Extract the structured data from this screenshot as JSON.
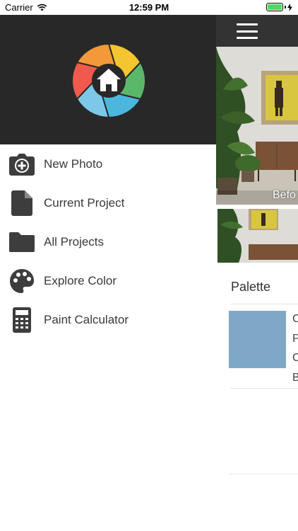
{
  "status_bar": {
    "carrier": "Carrier",
    "time": "12:59 PM",
    "battery_level": 1.0,
    "battery_color": "#4cd964"
  },
  "drawer": {
    "header_color": "#282828",
    "logo_icon": "camera-aperture-house-icon",
    "items": [
      {
        "label": "New Photo",
        "icon": "camera-add-icon"
      },
      {
        "label": "Current Project",
        "icon": "document-icon"
      },
      {
        "label": "All Projects",
        "icon": "folder-icon"
      },
      {
        "label": "Explore Color",
        "icon": "palette-icon"
      },
      {
        "label": "Paint Calculator",
        "icon": "calculator-icon"
      }
    ]
  },
  "main": {
    "bar_color": "#333333",
    "menu_icon": "hamburger-menu-icon",
    "hero_label": "Befo",
    "palette_title": "Palette",
    "swatch_color": "#7fa8c7",
    "swatch_text_lines": [
      "C",
      "P",
      "C",
      "B"
    ]
  }
}
